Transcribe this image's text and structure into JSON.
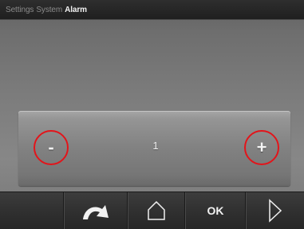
{
  "breadcrumb": {
    "items": [
      {
        "label": "Settings",
        "active": false
      },
      {
        "label": "System",
        "active": false
      },
      {
        "label": "Alarm",
        "active": true
      }
    ]
  },
  "panel": {
    "decrease_label": "-",
    "increase_label": "+",
    "value": "1"
  },
  "navbar": {
    "back_icon": "back-arrow-icon",
    "home_icon": "home-icon",
    "ok_label": "OK",
    "next_icon": "chevron-right-icon"
  },
  "colors": {
    "highlight_ring": "#e3141a",
    "topbar_bg": "#262626",
    "panel_bg": "#828282",
    "navbar_bg": "#323232"
  }
}
